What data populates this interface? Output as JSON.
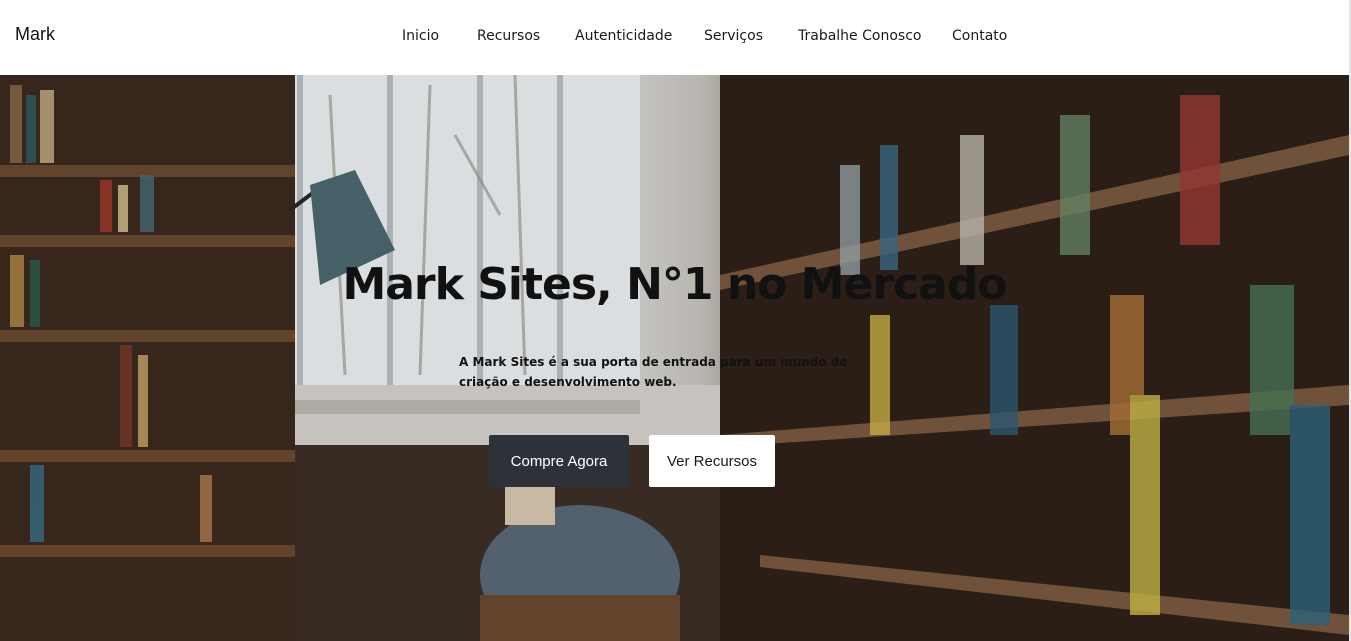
{
  "nav": {
    "brand": "Mark",
    "links": [
      "Inicio",
      "Recursos",
      "Autenticidade",
      "Serviços",
      "Trabalhe Conosco",
      "Contato"
    ]
  },
  "hero": {
    "title": "Mark Sites, N°1 no Mercado",
    "subtitle": "A Mark Sites é a sua porta de entrada para um mundo de criação e desenvolvimento web.",
    "primary_button": "Compre Agora",
    "secondary_button": "Ver Recursos"
  },
  "colors": {
    "primary_button_bg": "#2d313a",
    "secondary_button_bg": "#ffffff",
    "navbar_bg": "#ffffff"
  }
}
